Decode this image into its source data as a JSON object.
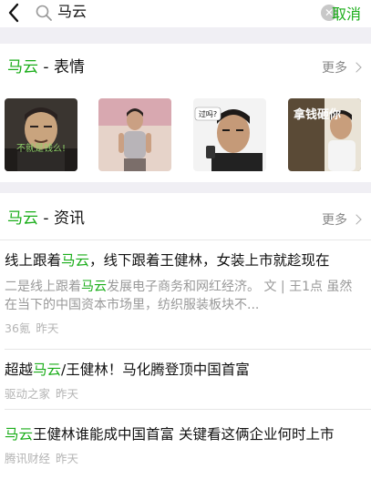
{
  "search": {
    "query": "马云",
    "cancel_label": "取消"
  },
  "stickers_section": {
    "keyword": "马云",
    "suffix": " - 表情",
    "more_label": "更多",
    "stickers": [
      {
        "name": "sticker-1",
        "caption": "不就是钱么!"
      },
      {
        "name": "sticker-2",
        "caption": ""
      },
      {
        "name": "sticker-3",
        "caption": "过吗?"
      },
      {
        "name": "sticker-4",
        "caption": "拿钱砸你"
      }
    ]
  },
  "news_section": {
    "keyword": "马云",
    "suffix": " - 资讯",
    "more_label": "更多",
    "items": [
      {
        "title_pre": "线上跟着",
        "title_kw": "马云",
        "title_post": "，线下跟着王健林，女装上市就趁现在",
        "snippet_pre": "二是线上跟着",
        "snippet_kw": "马云",
        "snippet_post": "发展电子商务和网红经济。 文 | 王1点 虽然在当下的中国资本市场里，纺织服装板块不...",
        "source": "36氪",
        "time": "昨天"
      },
      {
        "title_pre": "超越",
        "title_kw": "马云",
        "title_post": "/王健林！马化腾登顶中国首富",
        "source": "驱动之家",
        "time": "昨天"
      },
      {
        "title_pre": "",
        "title_kw": "马云",
        "title_post": "王健林谁能成中国首富 关键看这俩企业何时上市",
        "source": "腾讯财经",
        "time": "昨天"
      }
    ]
  },
  "colors": {
    "accent": "#1aad19",
    "background": "#f0eff4"
  }
}
